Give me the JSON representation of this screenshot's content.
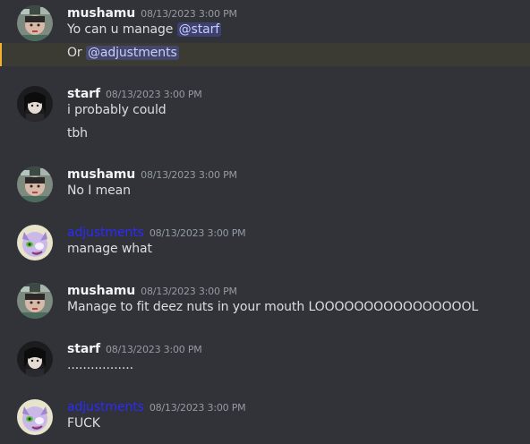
{
  "messages": [
    {
      "author": "mushamu",
      "author_color": "#f2f3f5",
      "timestamp": "08/13/2023 3:00 PM",
      "avatar_icon": "mushamu-avatar",
      "lines": [
        {
          "prefix": "Yo can u manage ",
          "mention": "@starf"
        },
        {
          "prefix": "Or ",
          "mention": "@adjustments"
        }
      ]
    },
    {
      "author": "starf",
      "author_color": "#f2f3f5",
      "timestamp": "08/13/2023 3:00 PM",
      "avatar_icon": "starf-avatar",
      "lines": [
        {
          "text": "i probably could"
        },
        {
          "text": "tbh"
        }
      ]
    },
    {
      "author": "mushamu",
      "author_color": "#f2f3f5",
      "timestamp": "08/13/2023 3:00 PM",
      "avatar_icon": "mushamu-avatar",
      "lines": [
        {
          "text": "No I mean"
        }
      ]
    },
    {
      "author": "adjustments",
      "author_color": "#2b2bff",
      "timestamp": "08/13/2023 3:00 PM",
      "avatar_icon": "adjustments-avatar",
      "lines": [
        {
          "text": "manage what"
        }
      ]
    },
    {
      "author": "mushamu",
      "author_color": "#f2f3f5",
      "timestamp": "08/13/2023 3:00 PM",
      "avatar_icon": "mushamu-avatar",
      "lines": [
        {
          "text": "Manage to fit deez nuts in your mouth LOOOOOOOOOOOOOOOOL"
        }
      ]
    },
    {
      "author": "starf",
      "author_color": "#f2f3f5",
      "timestamp": "08/13/2023 3:00 PM",
      "avatar_icon": "starf-avatar",
      "lines": [
        {
          "text": "................."
        }
      ]
    },
    {
      "author": "adjustments",
      "author_color": "#2b2bff",
      "timestamp": "08/13/2023 3:00 PM",
      "avatar_icon": "adjustments-avatar",
      "lines": [
        {
          "text": "FUCK"
        }
      ]
    }
  ],
  "colors": {
    "background": "#313338",
    "highlight_row": "#3b3b33",
    "highlight_bar": "#f0b232",
    "mention_bg": "#5865f24d",
    "text": "#dbdee1",
    "timestamp": "#949ba4"
  }
}
